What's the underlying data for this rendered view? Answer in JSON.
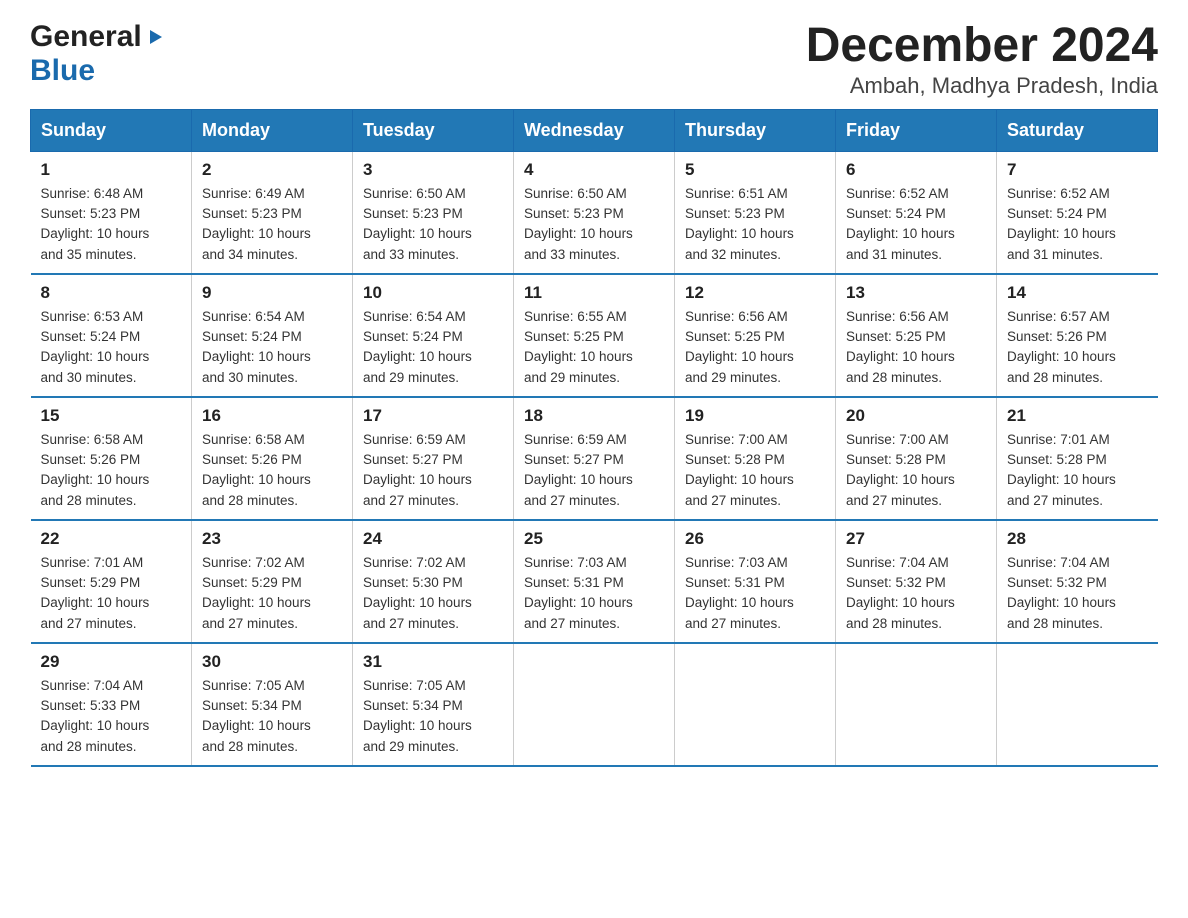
{
  "logo": {
    "general": "General",
    "blue": "Blue"
  },
  "header": {
    "month": "December 2024",
    "location": "Ambah, Madhya Pradesh, India"
  },
  "weekdays": [
    "Sunday",
    "Monday",
    "Tuesday",
    "Wednesday",
    "Thursday",
    "Friday",
    "Saturday"
  ],
  "weeks": [
    [
      {
        "day": "1",
        "sunrise": "6:48 AM",
        "sunset": "5:23 PM",
        "daylight": "10 hours and 35 minutes."
      },
      {
        "day": "2",
        "sunrise": "6:49 AM",
        "sunset": "5:23 PM",
        "daylight": "10 hours and 34 minutes."
      },
      {
        "day": "3",
        "sunrise": "6:50 AM",
        "sunset": "5:23 PM",
        "daylight": "10 hours and 33 minutes."
      },
      {
        "day": "4",
        "sunrise": "6:50 AM",
        "sunset": "5:23 PM",
        "daylight": "10 hours and 33 minutes."
      },
      {
        "day": "5",
        "sunrise": "6:51 AM",
        "sunset": "5:23 PM",
        "daylight": "10 hours and 32 minutes."
      },
      {
        "day": "6",
        "sunrise": "6:52 AM",
        "sunset": "5:24 PM",
        "daylight": "10 hours and 31 minutes."
      },
      {
        "day": "7",
        "sunrise": "6:52 AM",
        "sunset": "5:24 PM",
        "daylight": "10 hours and 31 minutes."
      }
    ],
    [
      {
        "day": "8",
        "sunrise": "6:53 AM",
        "sunset": "5:24 PM",
        "daylight": "10 hours and 30 minutes."
      },
      {
        "day": "9",
        "sunrise": "6:54 AM",
        "sunset": "5:24 PM",
        "daylight": "10 hours and 30 minutes."
      },
      {
        "day": "10",
        "sunrise": "6:54 AM",
        "sunset": "5:24 PM",
        "daylight": "10 hours and 29 minutes."
      },
      {
        "day": "11",
        "sunrise": "6:55 AM",
        "sunset": "5:25 PM",
        "daylight": "10 hours and 29 minutes."
      },
      {
        "day": "12",
        "sunrise": "6:56 AM",
        "sunset": "5:25 PM",
        "daylight": "10 hours and 29 minutes."
      },
      {
        "day": "13",
        "sunrise": "6:56 AM",
        "sunset": "5:25 PM",
        "daylight": "10 hours and 28 minutes."
      },
      {
        "day": "14",
        "sunrise": "6:57 AM",
        "sunset": "5:26 PM",
        "daylight": "10 hours and 28 minutes."
      }
    ],
    [
      {
        "day": "15",
        "sunrise": "6:58 AM",
        "sunset": "5:26 PM",
        "daylight": "10 hours and 28 minutes."
      },
      {
        "day": "16",
        "sunrise": "6:58 AM",
        "sunset": "5:26 PM",
        "daylight": "10 hours and 28 minutes."
      },
      {
        "day": "17",
        "sunrise": "6:59 AM",
        "sunset": "5:27 PM",
        "daylight": "10 hours and 27 minutes."
      },
      {
        "day": "18",
        "sunrise": "6:59 AM",
        "sunset": "5:27 PM",
        "daylight": "10 hours and 27 minutes."
      },
      {
        "day": "19",
        "sunrise": "7:00 AM",
        "sunset": "5:28 PM",
        "daylight": "10 hours and 27 minutes."
      },
      {
        "day": "20",
        "sunrise": "7:00 AM",
        "sunset": "5:28 PM",
        "daylight": "10 hours and 27 minutes."
      },
      {
        "day": "21",
        "sunrise": "7:01 AM",
        "sunset": "5:28 PM",
        "daylight": "10 hours and 27 minutes."
      }
    ],
    [
      {
        "day": "22",
        "sunrise": "7:01 AM",
        "sunset": "5:29 PM",
        "daylight": "10 hours and 27 minutes."
      },
      {
        "day": "23",
        "sunrise": "7:02 AM",
        "sunset": "5:29 PM",
        "daylight": "10 hours and 27 minutes."
      },
      {
        "day": "24",
        "sunrise": "7:02 AM",
        "sunset": "5:30 PM",
        "daylight": "10 hours and 27 minutes."
      },
      {
        "day": "25",
        "sunrise": "7:03 AM",
        "sunset": "5:31 PM",
        "daylight": "10 hours and 27 minutes."
      },
      {
        "day": "26",
        "sunrise": "7:03 AM",
        "sunset": "5:31 PM",
        "daylight": "10 hours and 27 minutes."
      },
      {
        "day": "27",
        "sunrise": "7:04 AM",
        "sunset": "5:32 PM",
        "daylight": "10 hours and 28 minutes."
      },
      {
        "day": "28",
        "sunrise": "7:04 AM",
        "sunset": "5:32 PM",
        "daylight": "10 hours and 28 minutes."
      }
    ],
    [
      {
        "day": "29",
        "sunrise": "7:04 AM",
        "sunset": "5:33 PM",
        "daylight": "10 hours and 28 minutes."
      },
      {
        "day": "30",
        "sunrise": "7:05 AM",
        "sunset": "5:34 PM",
        "daylight": "10 hours and 28 minutes."
      },
      {
        "day": "31",
        "sunrise": "7:05 AM",
        "sunset": "5:34 PM",
        "daylight": "10 hours and 29 minutes."
      },
      null,
      null,
      null,
      null
    ]
  ],
  "labels": {
    "sunrise": "Sunrise:",
    "sunset": "Sunset:",
    "daylight": "Daylight:"
  }
}
